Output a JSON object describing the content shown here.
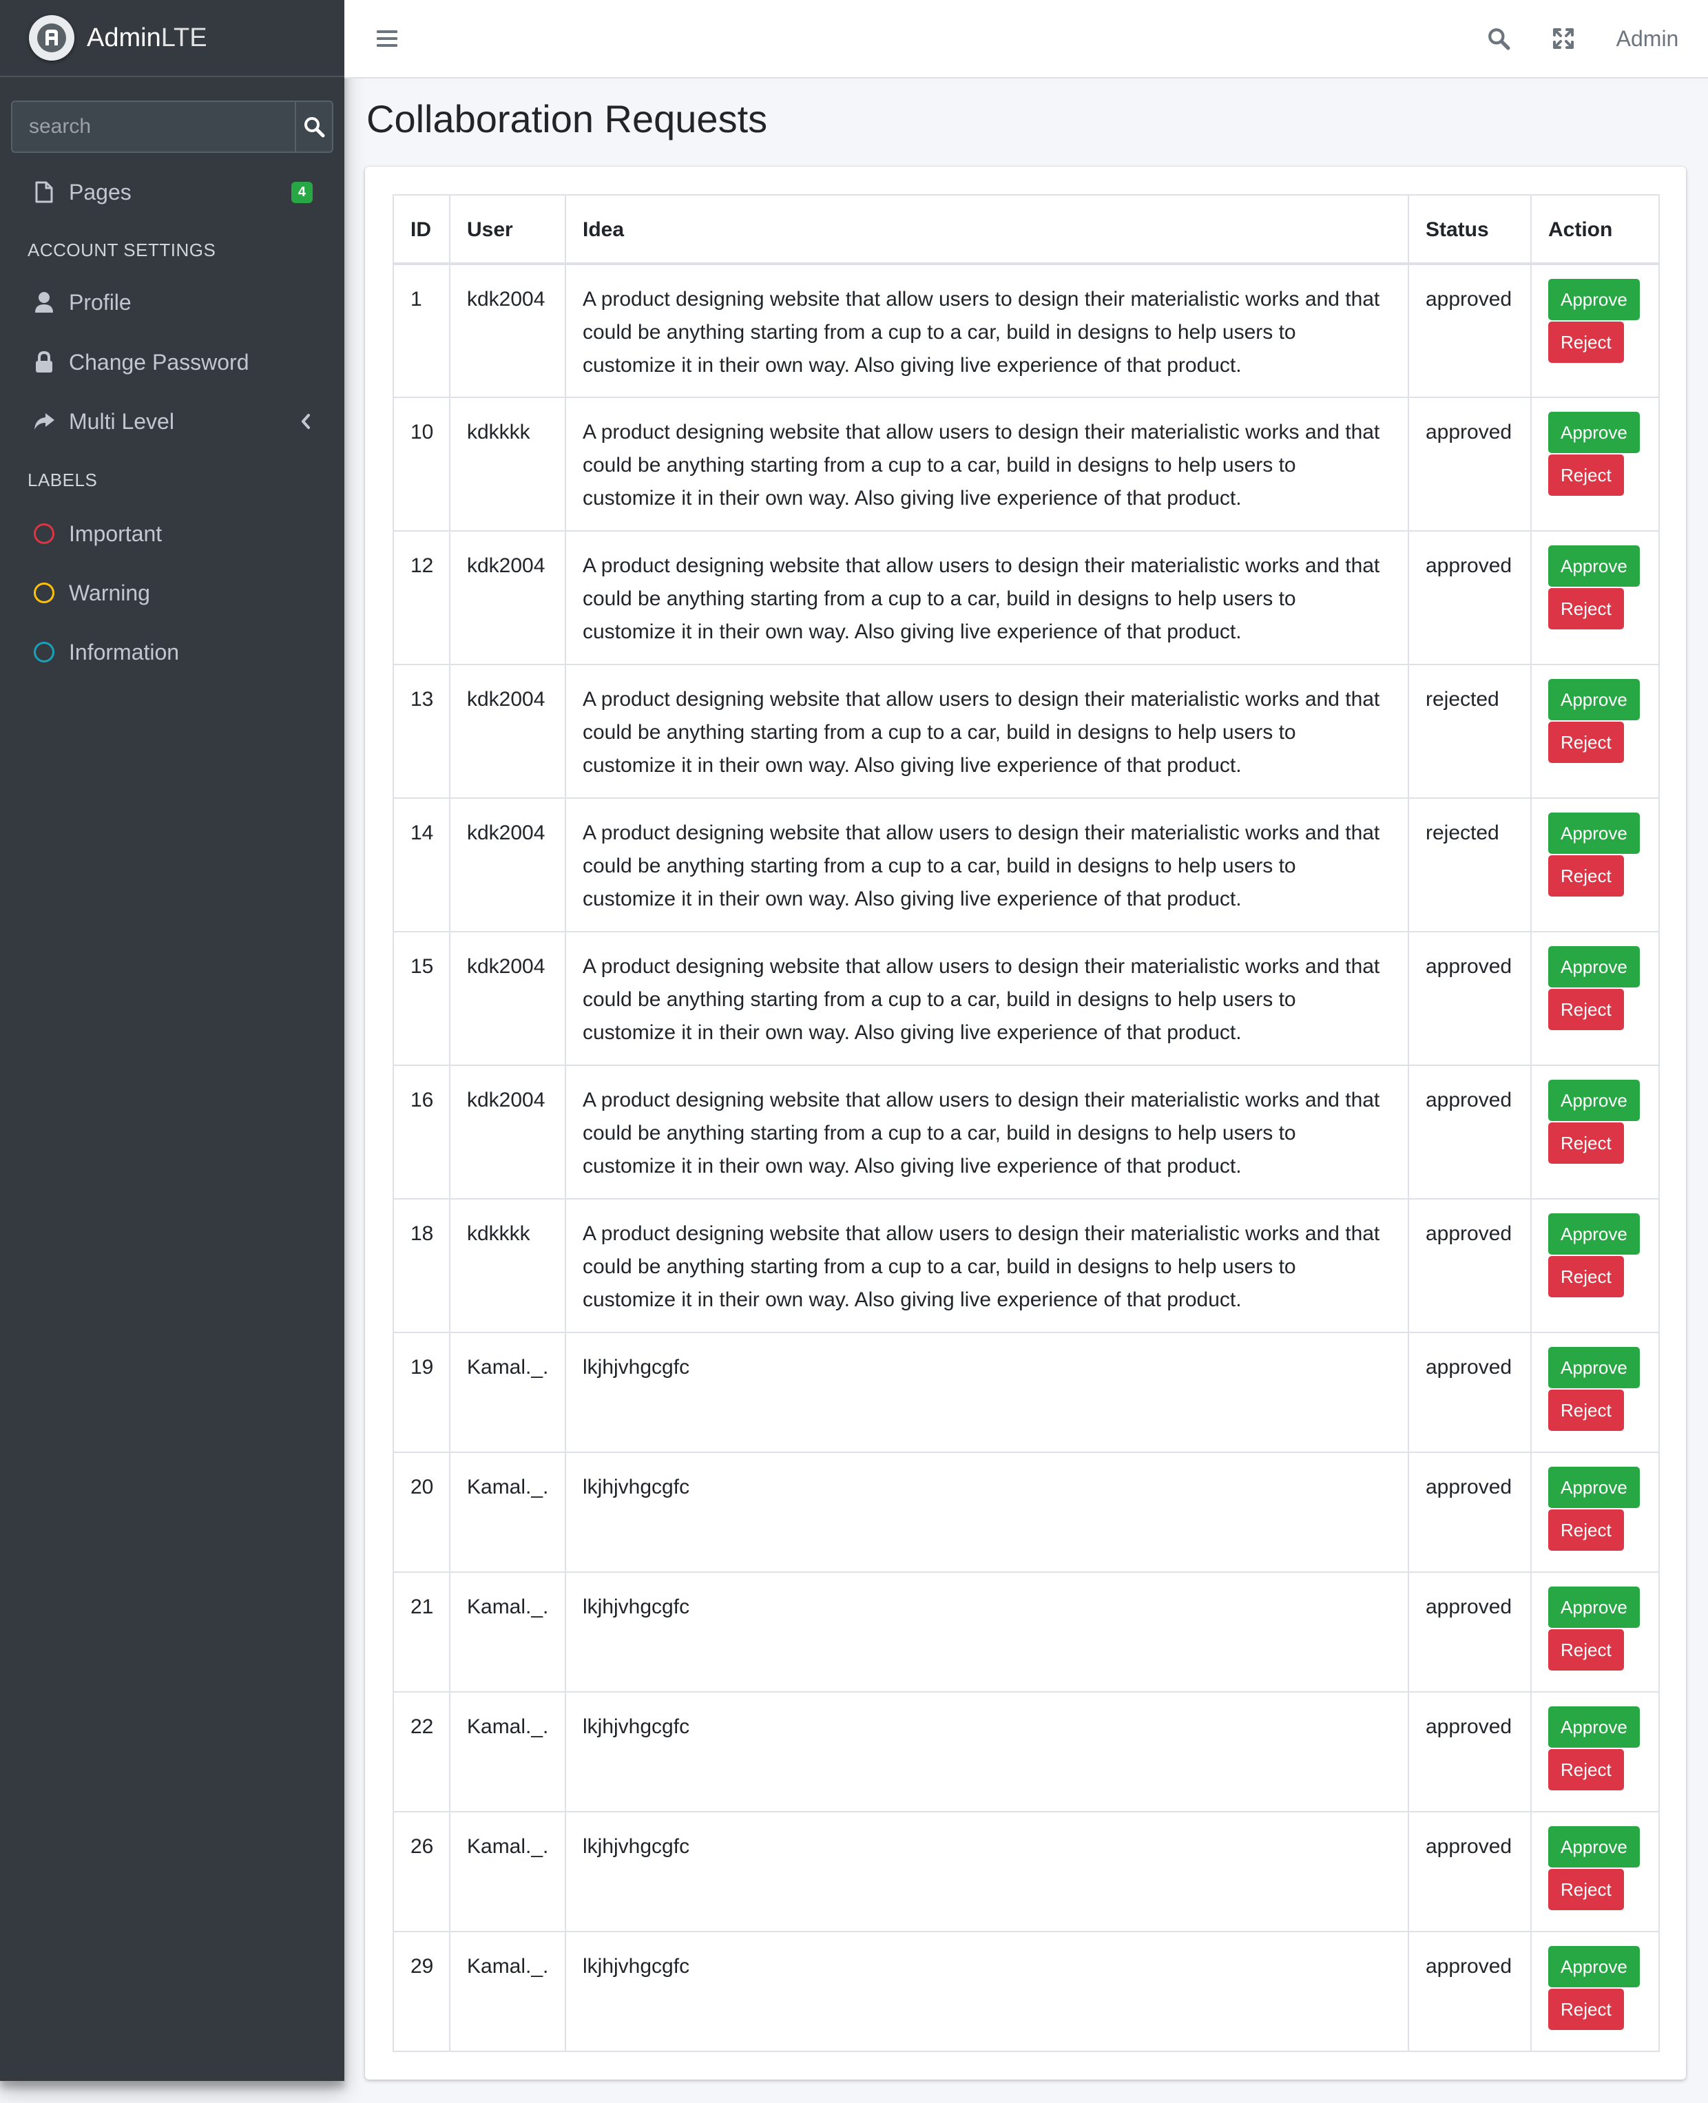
{
  "brand": {
    "name_bold": "Admin",
    "name_light": "LTE",
    "logo_letter": "A"
  },
  "sidebar": {
    "search": {
      "placeholder": "search"
    },
    "pages": {
      "label": "Pages",
      "badge": "4"
    },
    "account_header": "ACCOUNT SETTINGS",
    "profile": "Profile",
    "change_password": "Change Password",
    "multi_level": "Multi Level",
    "labels_header": "LABELS",
    "labels": [
      {
        "label": "Important",
        "color": "#dc3545"
      },
      {
        "label": "Warning",
        "color": "#ffc107"
      },
      {
        "label": "Information",
        "color": "#17a2b8"
      }
    ]
  },
  "navbar": {
    "user": "Admin"
  },
  "page": {
    "title": "Collaboration Requests"
  },
  "table": {
    "headers": [
      "ID",
      "User",
      "Idea",
      "Status",
      "Action"
    ],
    "approve_label": "Approve",
    "reject_label": "Reject",
    "rows": [
      {
        "id": "1",
        "user": "kdk2004",
        "idea": "A product designing website that allow users to design their materialistic works and that could be anything starting from a cup to a car, build in designs to help users to customize it in their own way. Also giving live experience of that product.",
        "status": "approved"
      },
      {
        "id": "10",
        "user": "kdkkkk",
        "idea": "A product designing website that allow users to design their materialistic works and that could be anything starting from a cup to a car, build in designs to help users to customize it in their own way. Also giving live experience of that product.",
        "status": "approved"
      },
      {
        "id": "12",
        "user": "kdk2004",
        "idea": "A product designing website that allow users to design their materialistic works and that could be anything starting from a cup to a car, build in designs to help users to customize it in their own way. Also giving live experience of that product.",
        "status": "approved"
      },
      {
        "id": "13",
        "user": "kdk2004",
        "idea": "A product designing website that allow users to design their materialistic works and that could be anything starting from a cup to a car, build in designs to help users to customize it in their own way. Also giving live experience of that product.",
        "status": "rejected"
      },
      {
        "id": "14",
        "user": "kdk2004",
        "idea": "A product designing website that allow users to design their materialistic works and that could be anything starting from a cup to a car, build in designs to help users to customize it in their own way. Also giving live experience of that product.",
        "status": "rejected"
      },
      {
        "id": "15",
        "user": "kdk2004",
        "idea": "A product designing website that allow users to design their materialistic works and that could be anything starting from a cup to a car, build in designs to help users to customize it in their own way. Also giving live experience of that product.",
        "status": "approved"
      },
      {
        "id": "16",
        "user": "kdk2004",
        "idea": "A product designing website that allow users to design their materialistic works and that could be anything starting from a cup to a car, build in designs to help users to customize it in their own way. Also giving live experience of that product.",
        "status": "approved"
      },
      {
        "id": "18",
        "user": "kdkkkk",
        "idea": "A product designing website that allow users to design their materialistic works and that could be anything starting from a cup to a car, build in designs to help users to customize it in their own way. Also giving live experience of that product.",
        "status": "approved"
      },
      {
        "id": "19",
        "user": "Kamal._.",
        "idea": "lkjhjvhgcgfc",
        "status": "approved"
      },
      {
        "id": "20",
        "user": "Kamal._.",
        "idea": "lkjhjvhgcgfc",
        "status": "approved"
      },
      {
        "id": "21",
        "user": "Kamal._.",
        "idea": "lkjhjvhgcgfc",
        "status": "approved"
      },
      {
        "id": "22",
        "user": "Kamal._.",
        "idea": "lkjhjvhgcgfc",
        "status": "approved"
      },
      {
        "id": "26",
        "user": "Kamal._.",
        "idea": "lkjhjvhgcgfc",
        "status": "approved"
      },
      {
        "id": "29",
        "user": "Kamal._.",
        "idea": "lkjhjvhgcgfc",
        "status": "approved"
      }
    ]
  }
}
